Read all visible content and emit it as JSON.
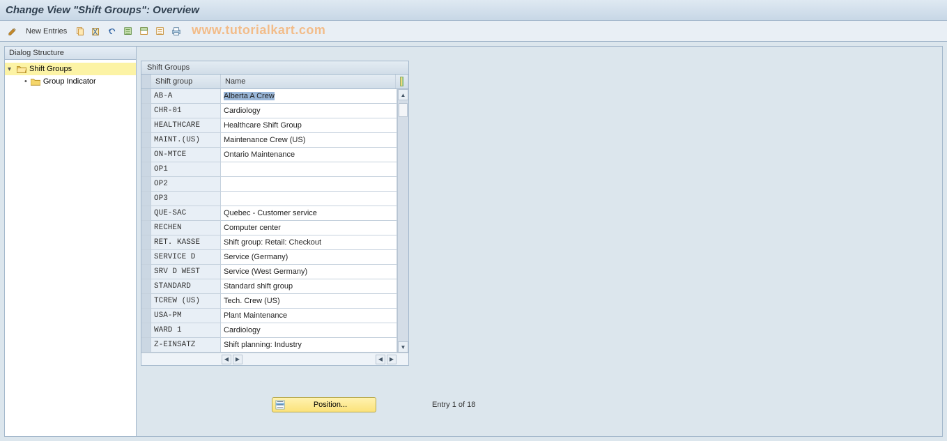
{
  "title": "Change View \"Shift Groups\": Overview",
  "toolbar": {
    "new_entries_label": "New Entries"
  },
  "watermark": "www.tutorialkart.com",
  "dialog_structure": {
    "header": "Dialog Structure",
    "items": [
      {
        "label": "Shift Groups",
        "selected": true,
        "expandable": true
      },
      {
        "label": "Group Indicator",
        "selected": false,
        "expandable": false
      }
    ]
  },
  "table": {
    "title": "Shift Groups",
    "columns": {
      "code": "Shift group",
      "name": "Name"
    },
    "rows": [
      {
        "code": "AB-A",
        "name": "Alberta A Crew"
      },
      {
        "code": "CHR-01",
        "name": "Cardiology"
      },
      {
        "code": "HEALTHCARE",
        "name": "Healthcare Shift Group"
      },
      {
        "code": "MAINT.(US)",
        "name": "Maintenance Crew (US)"
      },
      {
        "code": "ON-MTCE",
        "name": "Ontario Maintenance"
      },
      {
        "code": "OP1",
        "name": ""
      },
      {
        "code": "OP2",
        "name": ""
      },
      {
        "code": "OP3",
        "name": ""
      },
      {
        "code": "QUE-SAC",
        "name": "Quebec - Customer service"
      },
      {
        "code": "RECHEN",
        "name": "Computer center"
      },
      {
        "code": "RET. KASSE",
        "name": "Shift group: Retail: Checkout"
      },
      {
        "code": "SERVICE D",
        "name": "Service (Germany)"
      },
      {
        "code": "SRV D WEST",
        "name": "Service (West Germany)"
      },
      {
        "code": "STANDARD",
        "name": "Standard shift group"
      },
      {
        "code": "TCREW (US)",
        "name": "Tech. Crew (US)"
      },
      {
        "code": "USA-PM",
        "name": "Plant Maintenance"
      },
      {
        "code": "WARD 1",
        "name": "Cardiology"
      },
      {
        "code": "Z-EINSATZ",
        "name": "Shift planning: Industry"
      }
    ]
  },
  "footer": {
    "position_label": "Position...",
    "entry_text": "Entry 1 of 18"
  }
}
